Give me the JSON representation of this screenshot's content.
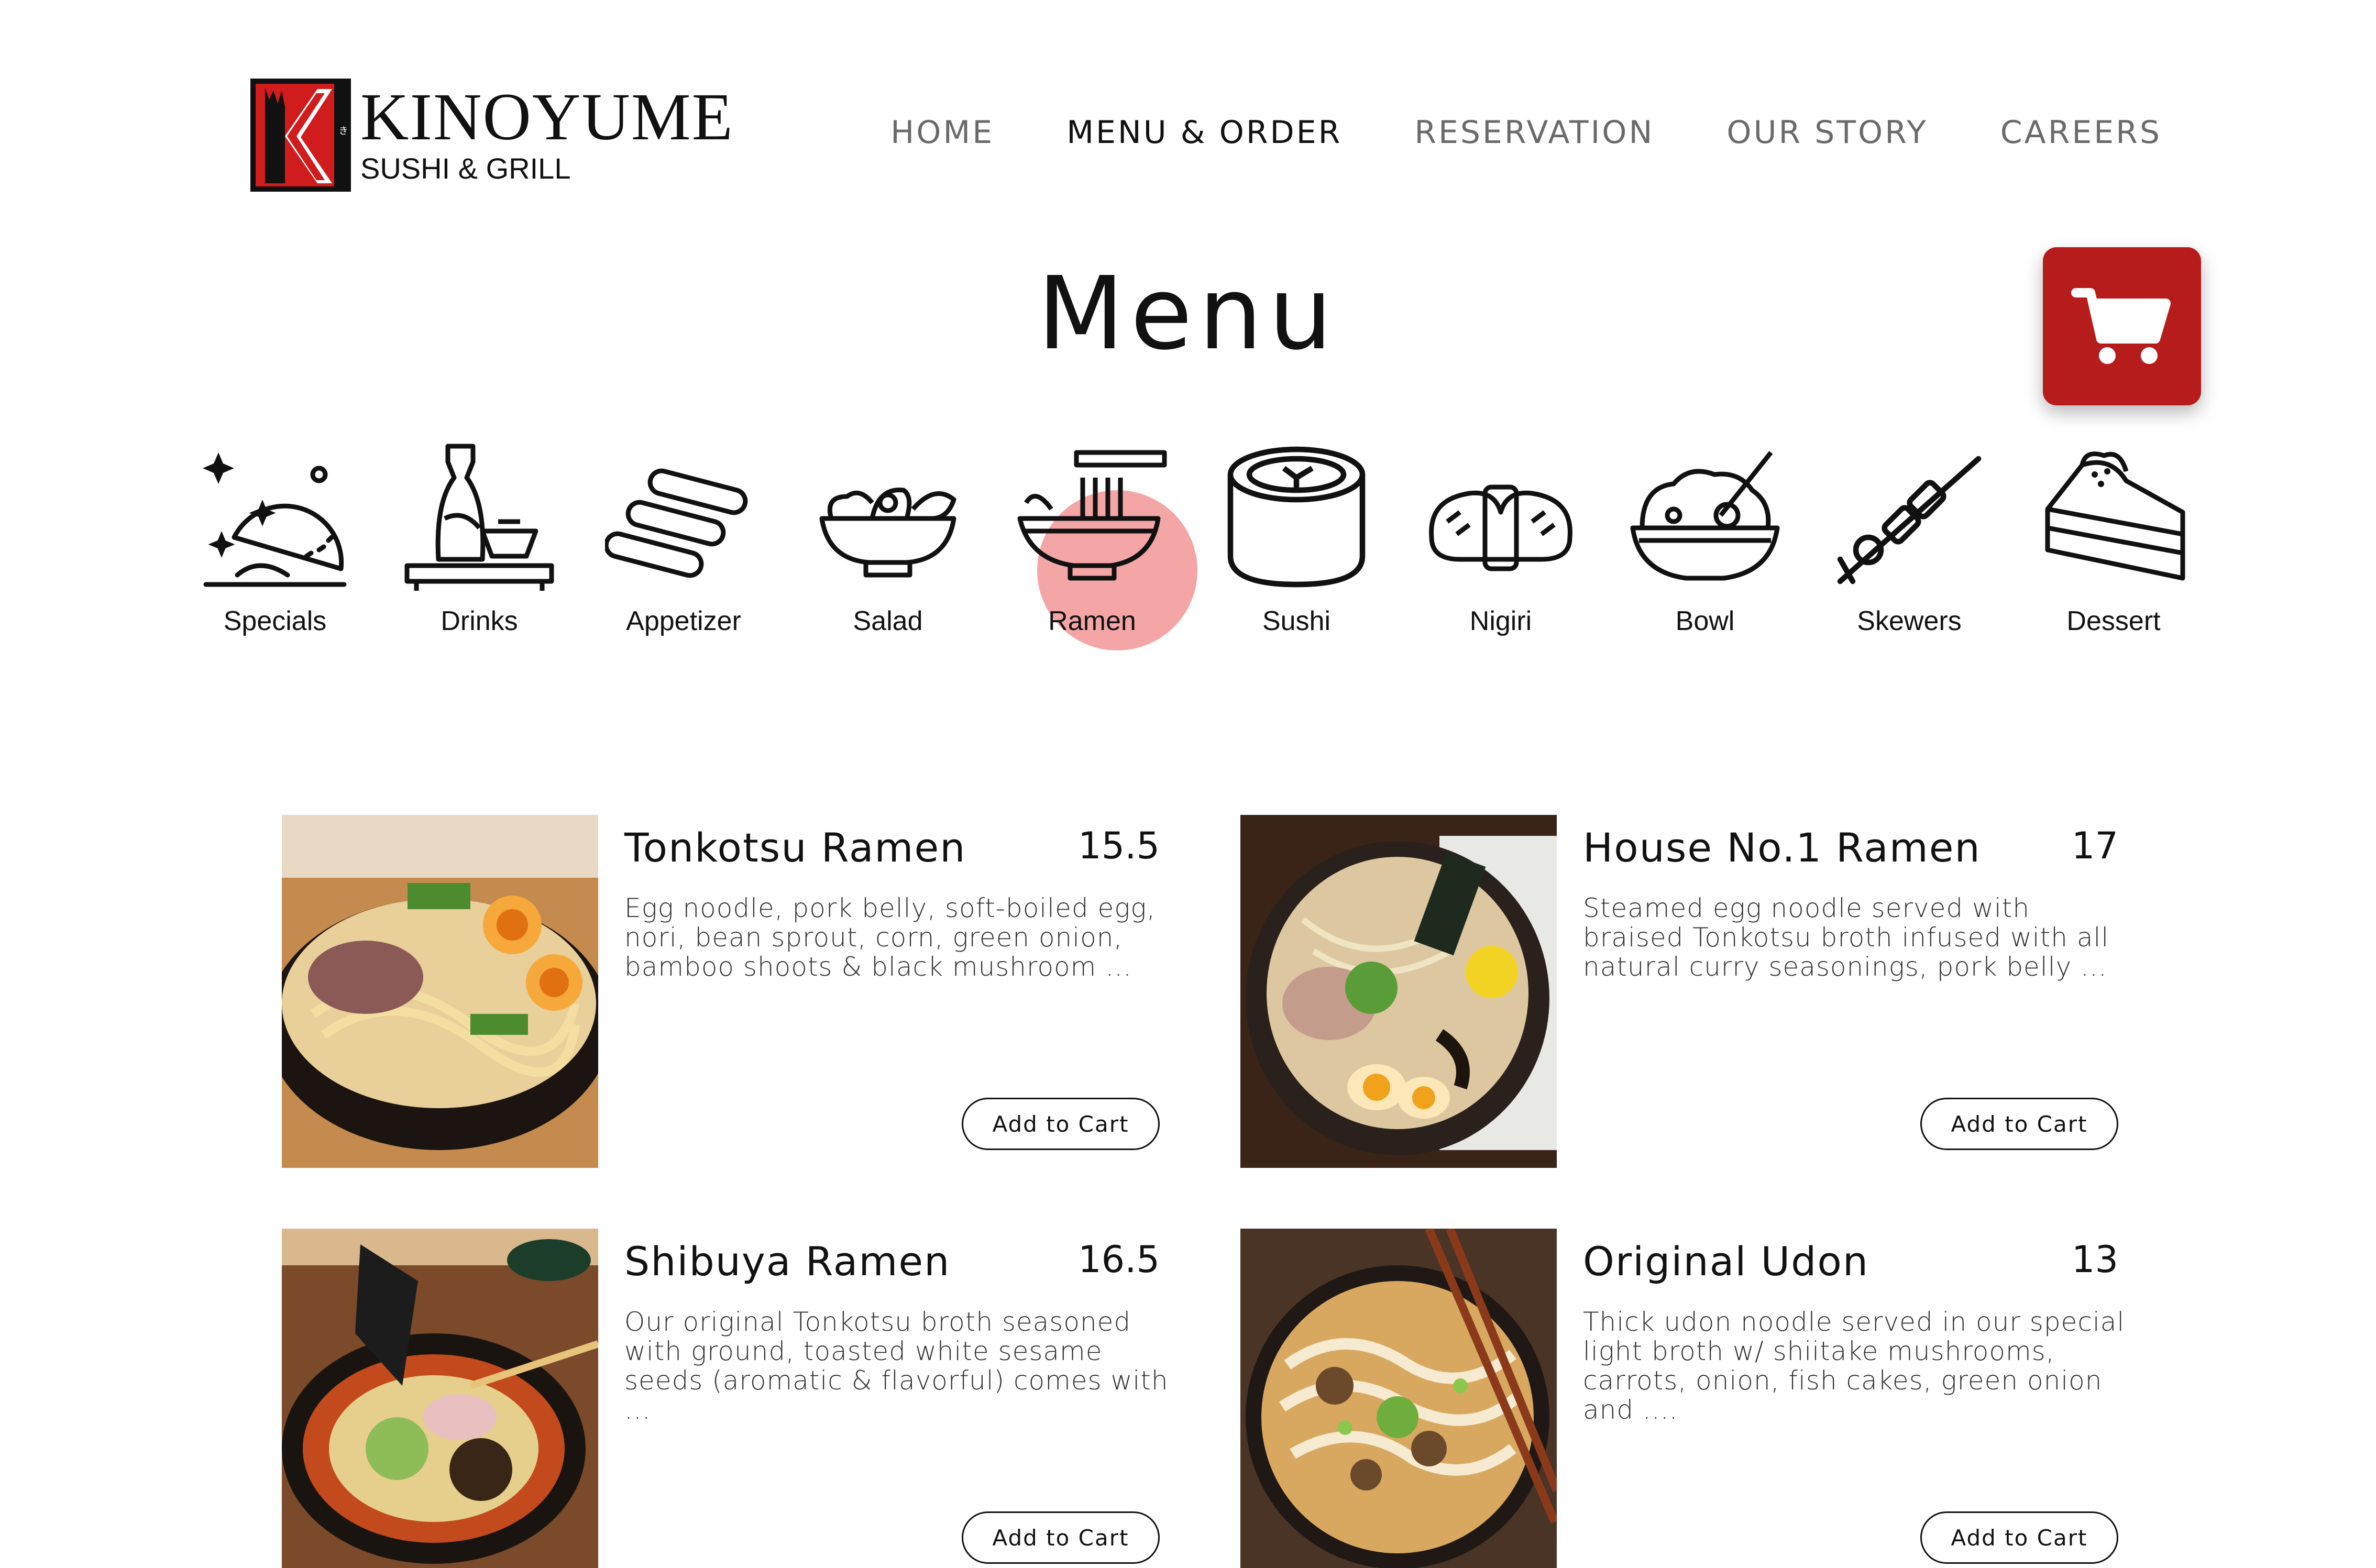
{
  "brand": {
    "name": "KINOYUME",
    "subtitle": "SUSHI & GRILL",
    "mark_letter": "K",
    "colors": {
      "mark_red": "#d01c1c",
      "mark_black": "#111111"
    }
  },
  "nav": {
    "items": [
      {
        "label": "HOME",
        "active": false
      },
      {
        "label": "MENU & ORDER",
        "active": true
      },
      {
        "label": "RESERVATION",
        "active": false
      },
      {
        "label": "OUR STORY",
        "active": false
      },
      {
        "label": "CAREERS",
        "active": false
      }
    ]
  },
  "page": {
    "title": "Menu"
  },
  "cart": {
    "icon": "shopping-cart-icon",
    "color": "#b71c1c"
  },
  "categories": [
    {
      "label": "Specials",
      "icon": "cloche-icon",
      "selected": false
    },
    {
      "label": "Drinks",
      "icon": "sake-bottle-icon",
      "selected": false
    },
    {
      "label": "Appetizer",
      "icon": "spring-roll-icon",
      "selected": false
    },
    {
      "label": "Salad",
      "icon": "salad-bowl-icon",
      "selected": false
    },
    {
      "label": "Ramen",
      "icon": "ramen-bowl-icon",
      "selected": true
    },
    {
      "label": "Sushi",
      "icon": "sushi-roll-icon",
      "selected": false
    },
    {
      "label": "Nigiri",
      "icon": "nigiri-icon",
      "selected": false
    },
    {
      "label": "Bowl",
      "icon": "rice-bowl-icon",
      "selected": false
    },
    {
      "label": "Skewers",
      "icon": "skewer-icon",
      "selected": false
    },
    {
      "label": "Dessert",
      "icon": "cake-slice-icon",
      "selected": false
    }
  ],
  "selected_highlight_color": "#f4a6a6",
  "menu_items": [
    {
      "name": "Tonkotsu Ramen",
      "price": "15.5",
      "description": "Egg noodle, pork belly, soft-boiled egg, nori, bean sprout, corn, green onion, bamboo shoots & black mushroom ...",
      "button": "Add to Cart"
    },
    {
      "name": "House No.1 Ramen",
      "price": "17",
      "description": "Steamed egg noodle served with braised Tonkotsu broth infused with all natural curry seasonings, pork belly ...",
      "button": "Add to Cart"
    },
    {
      "name": "Shibuya Ramen",
      "price": "16.5",
      "description": "Our original Tonkotsu broth seasoned with ground, toasted white sesame seeds (aromatic & flavorful) comes with ...",
      "button": "Add to Cart"
    },
    {
      "name": "Original Udon",
      "price": "13",
      "description": "Thick udon noodle served in our special light broth w/ shiitake mushrooms, carrots, onion, fish cakes, green onion and ....",
      "button": "Add to Cart"
    }
  ]
}
